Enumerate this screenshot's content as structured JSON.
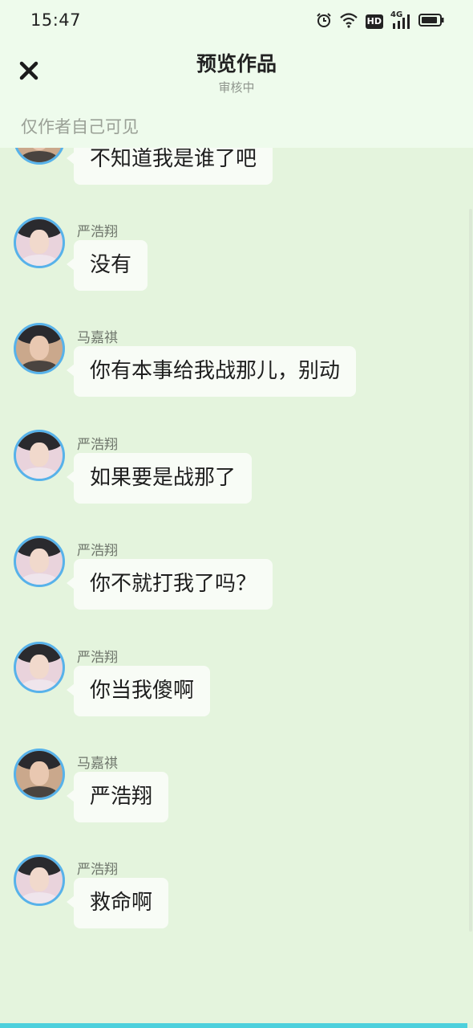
{
  "status_bar": {
    "time": "15:47",
    "network_badge": "HD",
    "network_type": "4G"
  },
  "nav": {
    "title": "预览作品",
    "subtitle": "审核中",
    "visibility_note": "仅作者自己可见"
  },
  "messages": [
    {
      "sender": "",
      "text": "不知道我是谁了吧",
      "avatar": "ma"
    },
    {
      "sender": "严浩翔",
      "text": "没有",
      "avatar": "yan"
    },
    {
      "sender": "马嘉祺",
      "text": "你有本事给我战那儿，别动",
      "avatar": "ma"
    },
    {
      "sender": "严浩翔",
      "text": "如果要是战那了",
      "avatar": "yan"
    },
    {
      "sender": "严浩翔",
      "text": "你不就打我了吗？",
      "avatar": "yan"
    },
    {
      "sender": "严浩翔",
      "text": "你当我傻啊",
      "avatar": "yan"
    },
    {
      "sender": "马嘉祺",
      "text": "严浩翔",
      "avatar": "ma"
    },
    {
      "sender": "严浩翔",
      "text": "救命啊",
      "avatar": "yan"
    }
  ],
  "colors": {
    "background": "#e4f4dd",
    "header": "#eefbec",
    "bubble": "#f8fcf6",
    "avatar_ring": "#57b2ea",
    "bottom_strip": "#4dd0dc"
  }
}
